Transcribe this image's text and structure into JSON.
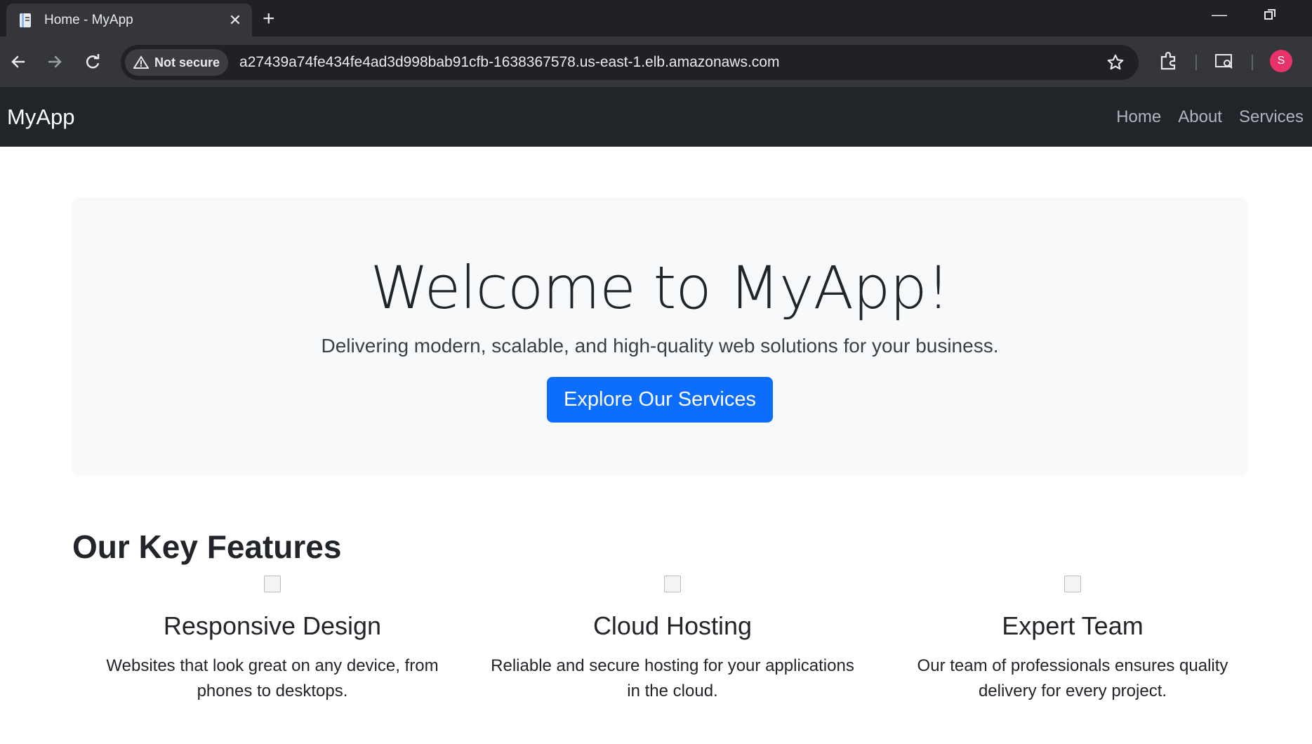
{
  "browser": {
    "tab_title": "Home - MyApp",
    "security_label": "Not secure",
    "url": "a27439a74fe434fe4ad3d998bab91cfb-1638367578.us-east-1.elb.amazonaws.com",
    "profile_initial": "S"
  },
  "site": {
    "brand": "MyApp",
    "nav": [
      "Home",
      "About",
      "Services"
    ]
  },
  "hero": {
    "title": "Welcome to MyApp!",
    "subtitle": "Delivering modern, scalable, and high-quality web solutions for your business.",
    "cta": "Explore Our Services",
    "cta_color": "#0d6efd"
  },
  "features": {
    "heading": "Our Key Features",
    "items": [
      {
        "title": "Responsive Design",
        "desc": "Websites that look great on any device, from phones to desktops."
      },
      {
        "title": "Cloud Hosting",
        "desc": "Reliable and secure hosting for your applications in the cloud."
      },
      {
        "title": "Expert Team",
        "desc": "Our team of professionals ensures quality delivery for every project."
      }
    ]
  }
}
